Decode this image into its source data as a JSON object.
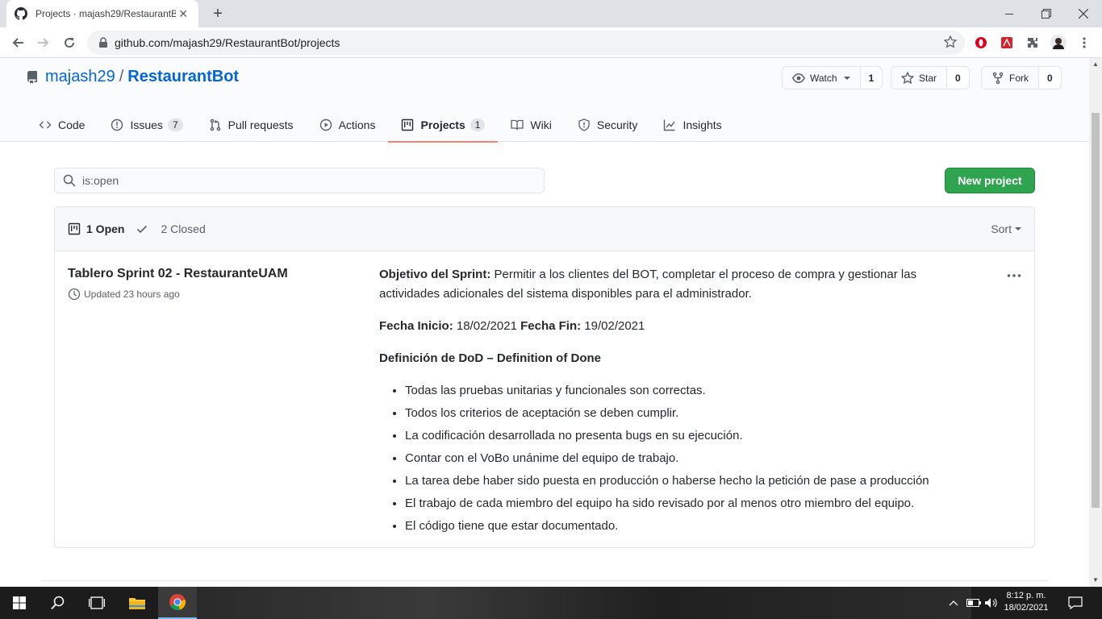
{
  "browser": {
    "tab_title": "Projects · majash29/RestaurantBot",
    "url": "github.com/majash29/RestaurantBot/projects"
  },
  "repo": {
    "owner": "majash29",
    "separator": "/",
    "name": "RestaurantBot",
    "watch_label": "Watch",
    "watch_count": "1",
    "star_label": "Star",
    "star_count": "0",
    "fork_label": "Fork",
    "fork_count": "0"
  },
  "nav": {
    "code": "Code",
    "issues": "Issues",
    "issues_count": "7",
    "pulls": "Pull requests",
    "actions": "Actions",
    "projects": "Projects",
    "projects_count": "1",
    "wiki": "Wiki",
    "security": "Security",
    "insights": "Insights"
  },
  "search": {
    "value": "is:open"
  },
  "new_project_label": "New project",
  "list_header": {
    "open_label": "1 Open",
    "closed_label": "2 Closed",
    "sort_label": "Sort"
  },
  "project": {
    "name": "Tablero Sprint 02 - RestauranteUAM",
    "updated": "Updated 23 hours ago",
    "objective_label": "Objetivo del Sprint:",
    "objective_text": " Permitir a los clientes del BOT, completar el proceso de compra y gestionar las actividades adicionales del sistema disponibles para el administrador.",
    "start_label": "Fecha Inicio:",
    "start_value": " 18/02/2021 ",
    "end_label": "Fecha Fin:",
    "end_value": " 19/02/2021",
    "dod_title": "Definición de DoD – Definition of Done",
    "dod_items": [
      "Todas las pruebas unitarias y funcionales son correctas.",
      "Todos los criterios de aceptación se deben cumplir.",
      "La codificación desarrollada no presenta bugs en su ejecución.",
      "Contar con el VoBo unánime del equipo de trabajo.",
      "La tarea debe haber sido puesta en producción o haberse hecho la petición de pase a producción",
      "El trabajo de cada miembro del equipo ha sido revisado por al menos otro miembro del equipo.",
      "El código tiene que estar documentado."
    ]
  },
  "taskbar": {
    "time": "8:12 p. m.",
    "date": "18/02/2021"
  },
  "colors": {
    "link": "#0366d6",
    "primary_button": "#2ea44f",
    "nav_underline": "#f9826c"
  }
}
